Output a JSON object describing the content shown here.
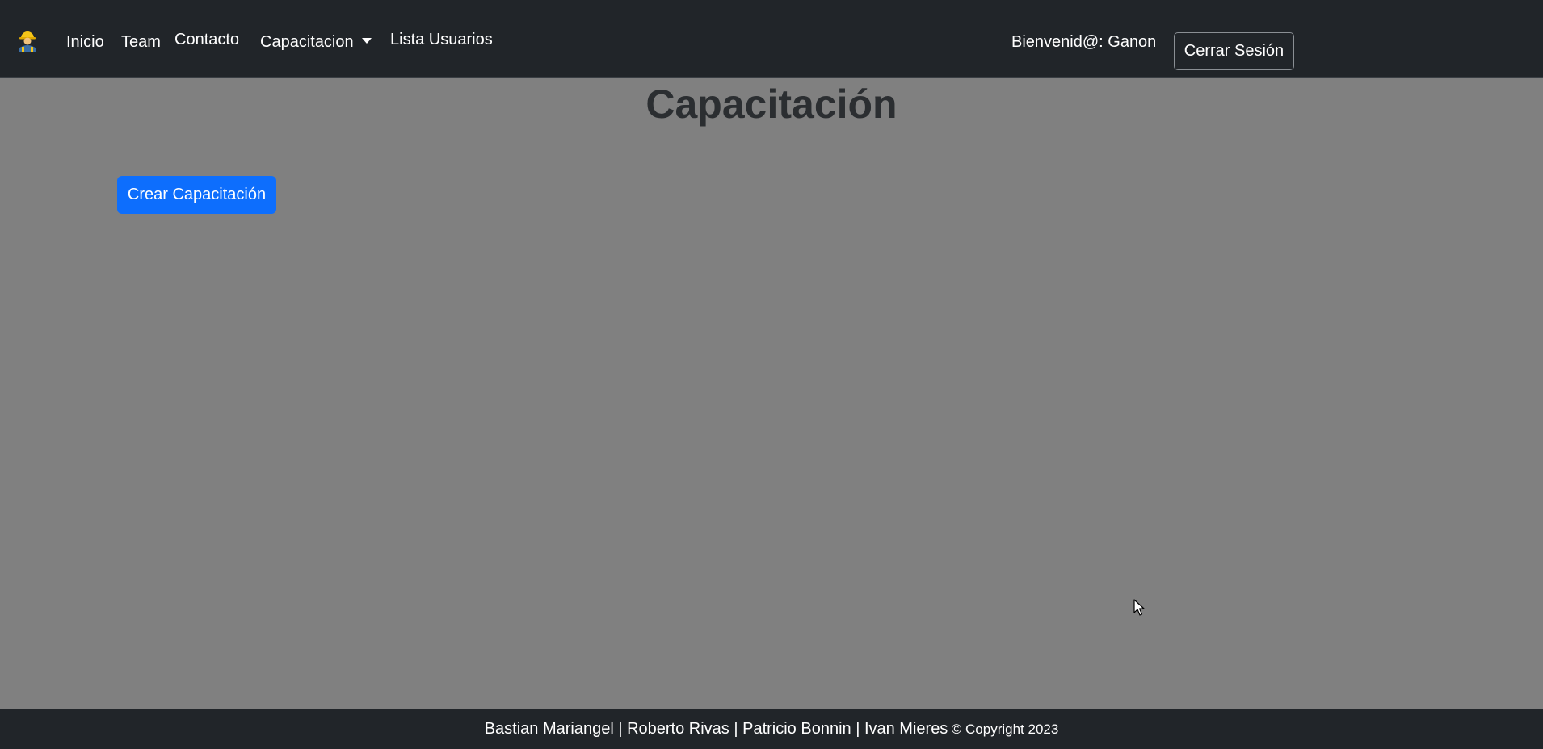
{
  "navbar": {
    "brand_icon": "construction-worker-icon",
    "links": {
      "inicio": "Inicio",
      "team": "Team",
      "contacto": "Contacto",
      "capacitacion": "Capacitacion",
      "lista_usuarios": "Lista Usuarios"
    },
    "welcome_text": "Bienvenid@: Ganon",
    "logout_label": "Cerrar Sesión"
  },
  "main": {
    "title": "Capacitación",
    "create_button_label": "Crear Capacitación"
  },
  "footer": {
    "authors": "Bastian Mariangel | Roberto Rivas | Patricio Bonnin | Ivan Mieres",
    "copyright": "© Copyright 2023"
  },
  "colors": {
    "navbar_bg": "#212529",
    "page_bg": "#808080",
    "primary": "#0d6efd",
    "title_text": "#2b2e31"
  }
}
